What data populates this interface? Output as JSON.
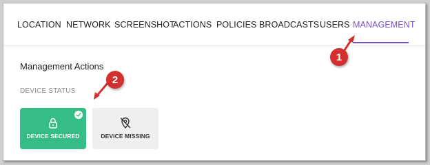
{
  "tabs": [
    {
      "label": "LOCATION"
    },
    {
      "label": "NETWORK"
    },
    {
      "label": "SCREENSHOT"
    },
    {
      "label": "ACTIONS"
    },
    {
      "label": "POLICIES"
    },
    {
      "label": "BROADCASTS"
    },
    {
      "label": "USERS"
    },
    {
      "label": "MANAGEMENT",
      "active": true
    }
  ],
  "section": {
    "title": "Management Actions",
    "subtitle": "DEVICE STATUS"
  },
  "cards": {
    "secured": {
      "label": "DEVICE SECURED",
      "selected": true
    },
    "missing": {
      "label": "DEVICE MISSING",
      "selected": false
    }
  },
  "callouts": {
    "one": "1",
    "two": "2"
  },
  "colors": {
    "accent": "#7c4fd1",
    "secured_bg": "#35bd85",
    "missing_bg": "#efefef",
    "callout": "#d32f2f"
  }
}
